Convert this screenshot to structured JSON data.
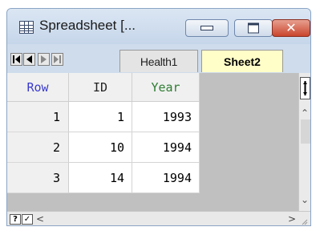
{
  "window": {
    "title": "Spreadsheet [...",
    "controls": {
      "minimize": "",
      "maximize": "",
      "close": "✕"
    }
  },
  "sheet_tabs": [
    {
      "label": "Health1",
      "active": false
    },
    {
      "label": "Sheet2",
      "active": true
    }
  ],
  "grid": {
    "columns": [
      {
        "label": "Row",
        "color": "#3a3acc"
      },
      {
        "label": "ID",
        "color": "#222222"
      },
      {
        "label": "Year",
        "color": "#2e7d32"
      }
    ],
    "rows": [
      {
        "row": "1",
        "id": "1",
        "year": "1993"
      },
      {
        "row": "2",
        "id": "10",
        "year": "1994"
      },
      {
        "row": "3",
        "id": "14",
        "year": "1994"
      }
    ]
  },
  "bottom_bar": {
    "help_label": "?",
    "check_label": "✓"
  }
}
